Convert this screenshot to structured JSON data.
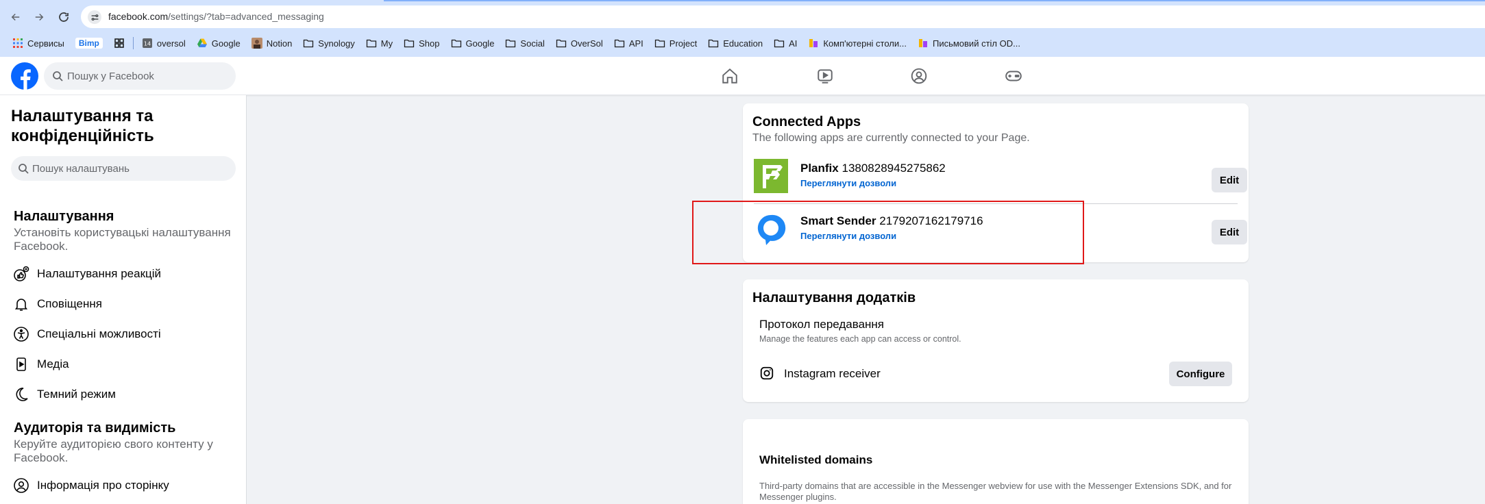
{
  "browser": {
    "url_host": "facebook.com",
    "url_path": "/settings/?tab=advanced_messaging",
    "bookmarks": [
      {
        "label": "Сервисы",
        "icon": "apps-grid-icon"
      },
      {
        "label": "Bimp",
        "icon": "bimp-badge-icon"
      },
      {
        "label": "",
        "icon": "grid-icon"
      },
      {
        "label": "oversol",
        "icon": "calendar-14-icon"
      },
      {
        "label": "Google",
        "icon": "google-drive-icon"
      },
      {
        "label": "Notion",
        "icon": "notion-avatar-icon"
      },
      {
        "label": "Synology",
        "icon": "folder-icon"
      },
      {
        "label": "My",
        "icon": "folder-icon"
      },
      {
        "label": "Shop",
        "icon": "folder-icon"
      },
      {
        "label": "Google",
        "icon": "folder-icon"
      },
      {
        "label": "Social",
        "icon": "folder-icon"
      },
      {
        "label": "OverSol",
        "icon": "folder-icon"
      },
      {
        "label": "API",
        "icon": "folder-icon"
      },
      {
        "label": "Project",
        "icon": "folder-icon"
      },
      {
        "label": "Education",
        "icon": "folder-icon"
      },
      {
        "label": "AI",
        "icon": "folder-icon"
      },
      {
        "label": "Комп'ютерні столи...",
        "icon": "shop-favicon-icon"
      },
      {
        "label": "Письмовий стіл OD...",
        "icon": "shop-favicon-icon"
      }
    ]
  },
  "header": {
    "search_placeholder": "Пошук у Facebook"
  },
  "sidebar": {
    "title": "Налаштування та конфіденційність",
    "search_placeholder": "Пошук налаштувань",
    "section1": {
      "heading": "Налаштування",
      "description": "Установіть користувацькі налаштування Facebook."
    },
    "items1": [
      {
        "label": "Налаштування реакцій",
        "icon": "reactions-icon"
      },
      {
        "label": "Сповіщення",
        "icon": "bell-icon"
      },
      {
        "label": "Спеціальні можливості",
        "icon": "accessibility-icon"
      },
      {
        "label": "Медіа",
        "icon": "media-icon"
      },
      {
        "label": "Темний режим",
        "icon": "moon-icon"
      }
    ],
    "section2": {
      "heading": "Аудиторія та видимість",
      "description": "Керуйте аудиторією свого контенту у Facebook."
    },
    "items2": [
      {
        "label": "Інформація про сторінку",
        "icon": "profile-icon"
      }
    ]
  },
  "connected_apps": {
    "title": "Connected Apps",
    "subtitle": "The following apps are currently connected to your Page.",
    "apps": [
      {
        "name": "Planfix",
        "id": "1380828945275862",
        "link": "Переглянути дозволи",
        "button": "Edit",
        "color": "#7cb82f"
      },
      {
        "name": "Smart Sender",
        "id": "2179207162179716",
        "link": "Переглянути дозволи",
        "button": "Edit",
        "color": "#1e88f5"
      }
    ]
  },
  "app_settings": {
    "title": "Налаштування додатків",
    "protocol_title": "Протокол передавання",
    "protocol_desc": "Manage the features each app can access or control.",
    "receiver_label": "Instagram receiver",
    "configure_button": "Configure"
  },
  "whitelist": {
    "title": "Whitelisted domains",
    "description": "Third-party domains that are accessible in the Messenger webview for use with the Messenger Extensions SDK, and for Messenger plugins."
  }
}
